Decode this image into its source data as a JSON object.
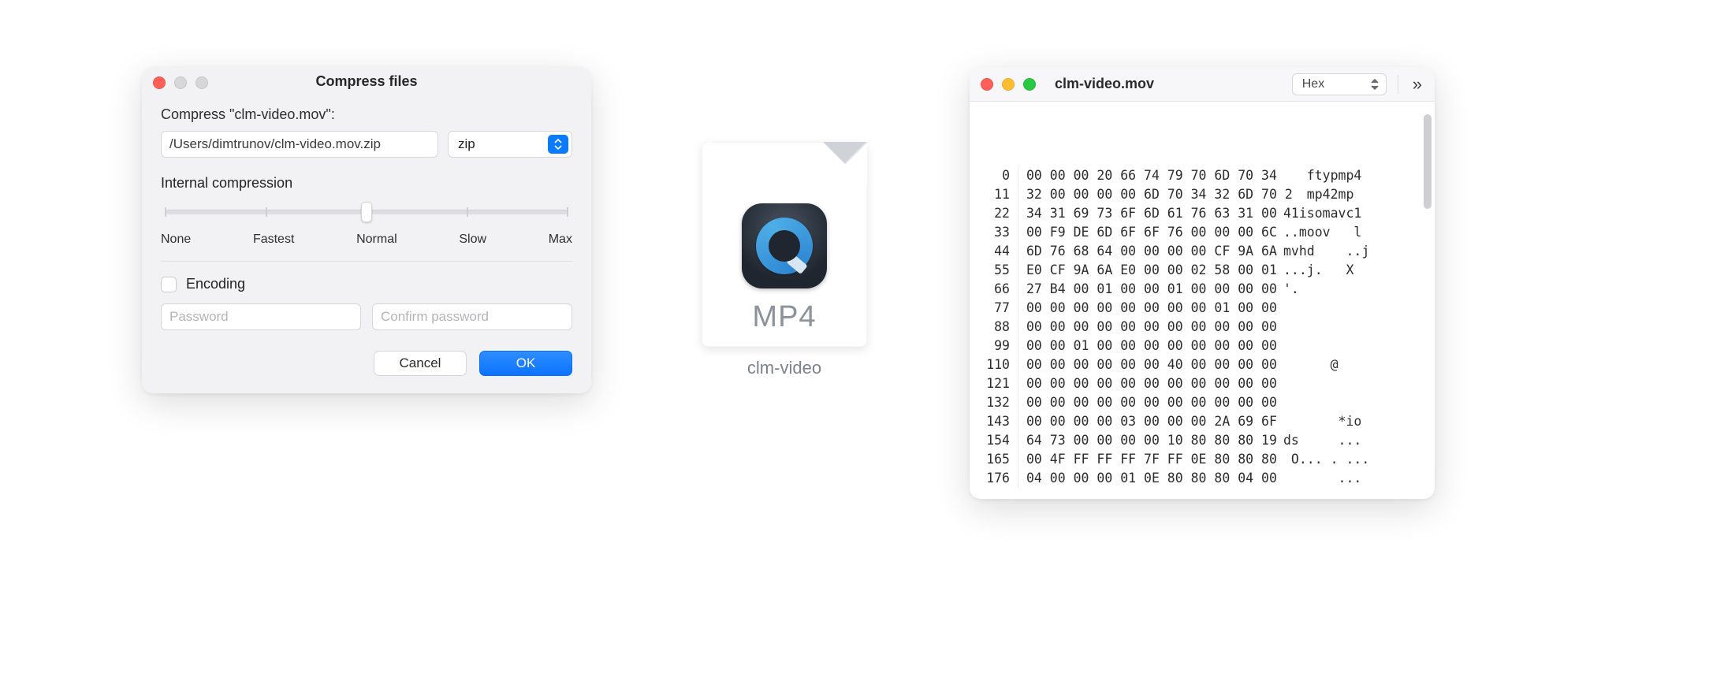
{
  "compress": {
    "title": "Compress files",
    "label": "Compress \"clm-video.mov\":",
    "path": "/Users/dimtrunov/clm-video.mov.zip",
    "format": "zip",
    "internal_label": "Internal compression",
    "slider_labels": [
      "None",
      "Fastest",
      "Normal",
      "Slow",
      "Max"
    ],
    "slider_value_index": 2,
    "encoding_label": "Encoding",
    "password_placeholder": "Password",
    "confirm_placeholder": "Confirm password",
    "cancel": "Cancel",
    "ok": "OK"
  },
  "file": {
    "ext": "MP4",
    "name": "clm-video"
  },
  "hexview": {
    "title": "clm-video.mov",
    "mode": "Hex",
    "overflow_glyph": "»",
    "rows": [
      {
        "off": "0",
        "bytes": "00 00 00 20 66 74 79 70 6D 70 34",
        "ascii": "   ftypmp4"
      },
      {
        "off": "11",
        "bytes": "32 00 00 00 00 6D 70 34 32 6D 70 2",
        "ascii": "   mp42mp"
      },
      {
        "off": "22",
        "bytes": "34 31 69 73 6F 6D 61 76 63 31 00",
        "ascii": "41isomavc1"
      },
      {
        "off": "33",
        "bytes": "00 F9 DE 6D 6F 6F 76 00 00 00 6C",
        "ascii": "..moov   l"
      },
      {
        "off": "44",
        "bytes": "6D 76 68 64 00 00 00 00 CF 9A 6A",
        "ascii": "mvhd    ..j"
      },
      {
        "off": "55",
        "bytes": "E0 CF 9A 6A E0 00 00 02 58 00 01",
        "ascii": "...j.   X"
      },
      {
        "off": "66",
        "bytes": "27 B4 00 01 00 00 01 00 00 00 00",
        "ascii": "'."
      },
      {
        "off": "77",
        "bytes": "00 00 00 00 00 00 00 00 01 00 00",
        "ascii": ""
      },
      {
        "off": "88",
        "bytes": "00 00 00 00 00 00 00 00 00 00 00",
        "ascii": ""
      },
      {
        "off": "99",
        "bytes": "00 00 01 00 00 00 00 00 00 00 00",
        "ascii": ""
      },
      {
        "off": "110",
        "bytes": "00 00 00 00 00 00 40 00 00 00 00",
        "ascii": "      @"
      },
      {
        "off": "121",
        "bytes": "00 00 00 00 00 00 00 00 00 00 00",
        "ascii": ""
      },
      {
        "off": "132",
        "bytes": "00 00 00 00 00 00 00 00 00 00 00",
        "ascii": ""
      },
      {
        "off": "143",
        "bytes": "00 00 00 00 03 00 00 00 2A 69 6F",
        "ascii": "       *io"
      },
      {
        "off": "154",
        "bytes": "64 73 00 00 00 00 10 80 80 80 19",
        "ascii": "ds     ..."
      },
      {
        "off": "165",
        "bytes": "00 4F FF FF FF 7F FF 0E 80 80 80",
        "ascii": " O... . ..."
      },
      {
        "off": "176",
        "bytes": "04 00 00 00 01 0E 80 80 80 04 00",
        "ascii": "       ..."
      }
    ]
  }
}
